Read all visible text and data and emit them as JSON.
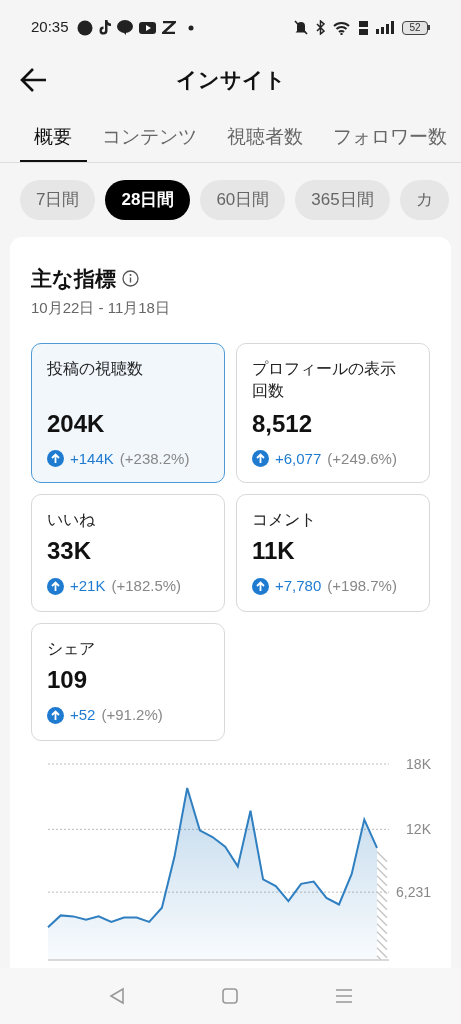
{
  "status_bar": {
    "time": "20:35",
    "battery": "52"
  },
  "header": {
    "title": "インサイト"
  },
  "tabs": [
    {
      "label": "概要",
      "selected": true
    },
    {
      "label": "コンテンツ",
      "selected": false
    },
    {
      "label": "視聴者数",
      "selected": false
    },
    {
      "label": "フォロワー数",
      "selected": false
    }
  ],
  "ranges": [
    {
      "label": "7日間",
      "selected": false
    },
    {
      "label": "28日間",
      "selected": true
    },
    {
      "label": "60日間",
      "selected": false
    },
    {
      "label": "365日間",
      "selected": false
    },
    {
      "label": "カ",
      "selected": false
    }
  ],
  "metrics_card": {
    "title": "主な指標",
    "date_range": "10月22日 - 11月18日",
    "metrics": [
      {
        "label": "投稿の視聴数",
        "value": "204K",
        "change": "+144K",
        "percent": "(+238.2%)",
        "selected": true
      },
      {
        "label": "プロフィールの表示回数",
        "value": "8,512",
        "change": "+6,077",
        "percent": "(+249.6%)",
        "selected": false
      },
      {
        "label": "いいね",
        "value": "33K",
        "change": "+21K",
        "percent": "(+182.5%)",
        "selected": false
      },
      {
        "label": "コメント",
        "value": "11K",
        "change": "+7,780",
        "percent": "(+198.7%)",
        "selected": false
      },
      {
        "label": "シェア",
        "value": "109",
        "change": "+52",
        "percent": "(+91.2%)",
        "selected": false
      }
    ],
    "chart_data": {
      "type": "area",
      "ylim": [
        0,
        18000
      ],
      "yticks": [
        {
          "value": 6231,
          "label": "6,231"
        },
        {
          "value": 12000,
          "label": "12K"
        },
        {
          "value": 18000,
          "label": "18K"
        }
      ],
      "values": [
        3000,
        4100,
        4000,
        3700,
        4000,
        3500,
        3900,
        3900,
        3500,
        4800,
        9500,
        15800,
        11900,
        11300,
        10400,
        8600,
        13700,
        7400,
        6800,
        5400,
        7000,
        7200,
        5700,
        5100,
        7900,
        12900,
        10300
      ]
    }
  }
}
